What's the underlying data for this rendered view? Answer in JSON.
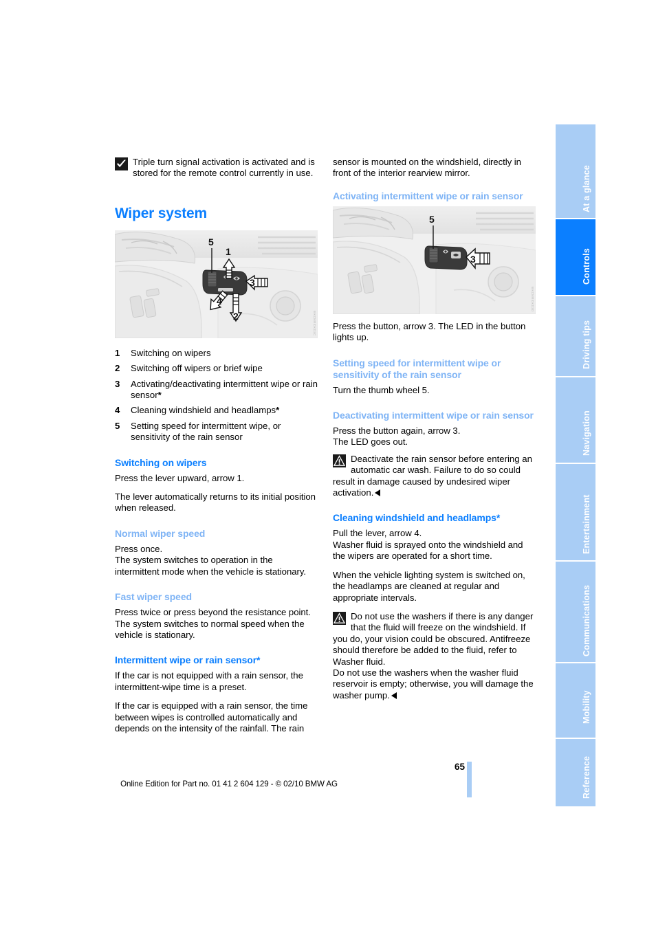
{
  "page": {
    "number": "65",
    "footer_text": "Online Edition for Part no. 01 41 2 604 129 - © 02/10 BMW AG"
  },
  "sidebar": {
    "tabs": [
      {
        "label": "At a glance",
        "active": false
      },
      {
        "label": "Controls",
        "active": true
      },
      {
        "label": "Driving tips",
        "active": false
      },
      {
        "label": "Navigation",
        "active": false
      },
      {
        "label": "Entertainment",
        "active": false
      },
      {
        "label": "Communications",
        "active": false
      },
      {
        "label": "Mobility",
        "active": false
      },
      {
        "label": "Reference",
        "active": false
      }
    ],
    "active_color": "#0b7fff",
    "inactive_color": "#a9cdf5"
  },
  "colors": {
    "heading_dark_blue": "#0b7fff",
    "heading_light_blue": "#7fb4f5"
  },
  "left_column": {
    "intro_note": "Triple turn signal activation is activated and is stored for the remote control currently in use.",
    "note_icon": "check-box-icon",
    "section_title": "Wiper system",
    "figure_code": "WKCMRIDKD3C",
    "figure_labels": [
      "1",
      "2",
      "3",
      "4",
      "5"
    ],
    "legend": [
      {
        "num": "1",
        "text": "Switching on wipers",
        "asterisk": false
      },
      {
        "num": "2",
        "text": "Switching off wipers or brief wipe",
        "asterisk": false
      },
      {
        "num": "3",
        "text": "Activating/deactivating intermittent wipe or rain sensor",
        "asterisk": true
      },
      {
        "num": "4",
        "text": "Cleaning windshield and headlamps",
        "asterisk": true
      },
      {
        "num": "5",
        "text": "Setting speed for intermittent wipe, or sensitivity of the rain sensor",
        "asterisk": false
      }
    ],
    "sections": [
      {
        "heading": "Switching on wipers",
        "heading_style": "dark",
        "paragraphs": [
          "Press the lever upward, arrow 1.",
          "The lever automatically returns to its initial position when released."
        ]
      },
      {
        "heading": "Normal wiper speed",
        "heading_style": "light",
        "paragraphs": [
          "Press once.\nThe system switches to operation in the intermittent mode when the vehicle is stationary."
        ]
      },
      {
        "heading": "Fast wiper speed",
        "heading_style": "light",
        "paragraphs": [
          "Press twice or press beyond the resistance point.\nThe system switches to normal speed when the vehicle is stationary."
        ]
      },
      {
        "heading": "Intermittent wipe or rain sensor*",
        "heading_style": "dark",
        "paragraphs": [
          "If the car is not equipped with a rain sensor, the intermittent-wipe time is a preset.",
          "If the car is equipped with a rain sensor, the time between wipes is controlled automatically and depends on the intensity of the rainfall. The rain"
        ]
      }
    ]
  },
  "right_column": {
    "continuation": "sensor is mounted on the windshield, directly in front of the interior rearview mirror.",
    "figure_code": "WKCMRIDKD3D",
    "figure_labels": [
      "3",
      "5"
    ],
    "sections": [
      {
        "heading": "Activating intermittent wipe or rain sensor",
        "heading_style": "light",
        "has_figure": true,
        "paragraphs": [
          "Press the button, arrow 3. The LED in the button lights up."
        ]
      },
      {
        "heading": "Setting speed for intermittent wipe or sensitivity of the rain sensor",
        "heading_style": "light",
        "paragraphs": [
          "Turn the thumb wheel 5."
        ]
      },
      {
        "heading": "Deactivating intermittent wipe or rain sensor",
        "heading_style": "light",
        "paragraphs": [
          "Press the button again, arrow 3.\nThe LED goes out."
        ],
        "warning": {
          "icon": "warning-triangle-icon",
          "text": "Deactivate the rain sensor before entering an automatic car wash. Failure to do so could result in damage caused by undesired wiper activation."
        }
      },
      {
        "heading": "Cleaning windshield and headlamps*",
        "heading_style": "dark",
        "paragraphs": [
          "Pull the lever, arrow 4.\nWasher fluid is sprayed onto the windshield and the wipers are operated for a short time.",
          "When the vehicle lighting system is switched on, the headlamps are cleaned at regular and appropriate intervals."
        ],
        "warning": {
          "icon": "warning-triangle-icon",
          "text": "Do not use the washers if there is any danger that the fluid will freeze on the windshield. If you do, your vision could be obscured. Antifreeze should therefore be added to the fluid, refer to Washer fluid.\nDo not use the washers when the washer fluid reservoir is empty; otherwise, you will damage the washer pump."
        }
      }
    ]
  }
}
